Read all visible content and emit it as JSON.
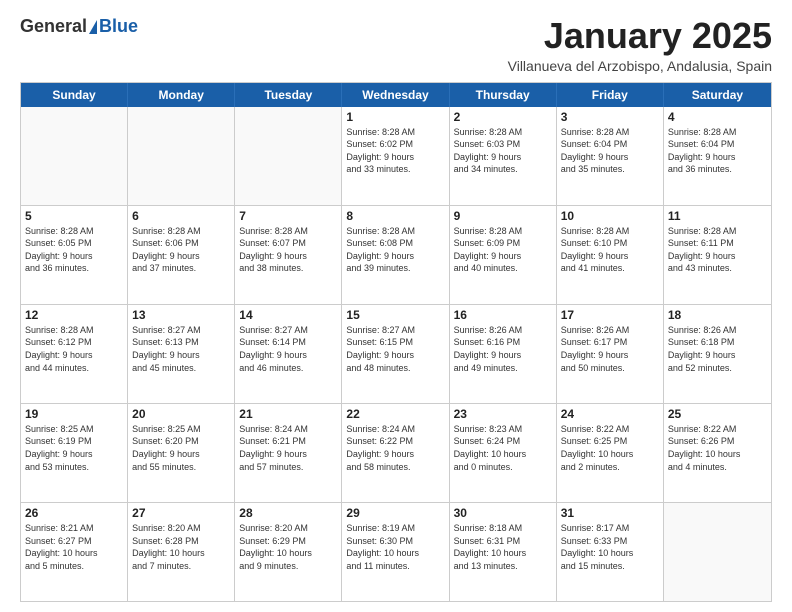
{
  "logo": {
    "general": "General",
    "blue": "Blue"
  },
  "title": "January 2025",
  "location": "Villanueva del Arzobispo, Andalusia, Spain",
  "days_of_week": [
    "Sunday",
    "Monday",
    "Tuesday",
    "Wednesday",
    "Thursday",
    "Friday",
    "Saturday"
  ],
  "weeks": [
    [
      {
        "day": "",
        "info": ""
      },
      {
        "day": "",
        "info": ""
      },
      {
        "day": "",
        "info": ""
      },
      {
        "day": "1",
        "info": "Sunrise: 8:28 AM\nSunset: 6:02 PM\nDaylight: 9 hours\nand 33 minutes."
      },
      {
        "day": "2",
        "info": "Sunrise: 8:28 AM\nSunset: 6:03 PM\nDaylight: 9 hours\nand 34 minutes."
      },
      {
        "day": "3",
        "info": "Sunrise: 8:28 AM\nSunset: 6:04 PM\nDaylight: 9 hours\nand 35 minutes."
      },
      {
        "day": "4",
        "info": "Sunrise: 8:28 AM\nSunset: 6:04 PM\nDaylight: 9 hours\nand 36 minutes."
      }
    ],
    [
      {
        "day": "5",
        "info": "Sunrise: 8:28 AM\nSunset: 6:05 PM\nDaylight: 9 hours\nand 36 minutes."
      },
      {
        "day": "6",
        "info": "Sunrise: 8:28 AM\nSunset: 6:06 PM\nDaylight: 9 hours\nand 37 minutes."
      },
      {
        "day": "7",
        "info": "Sunrise: 8:28 AM\nSunset: 6:07 PM\nDaylight: 9 hours\nand 38 minutes."
      },
      {
        "day": "8",
        "info": "Sunrise: 8:28 AM\nSunset: 6:08 PM\nDaylight: 9 hours\nand 39 minutes."
      },
      {
        "day": "9",
        "info": "Sunrise: 8:28 AM\nSunset: 6:09 PM\nDaylight: 9 hours\nand 40 minutes."
      },
      {
        "day": "10",
        "info": "Sunrise: 8:28 AM\nSunset: 6:10 PM\nDaylight: 9 hours\nand 41 minutes."
      },
      {
        "day": "11",
        "info": "Sunrise: 8:28 AM\nSunset: 6:11 PM\nDaylight: 9 hours\nand 43 minutes."
      }
    ],
    [
      {
        "day": "12",
        "info": "Sunrise: 8:28 AM\nSunset: 6:12 PM\nDaylight: 9 hours\nand 44 minutes."
      },
      {
        "day": "13",
        "info": "Sunrise: 8:27 AM\nSunset: 6:13 PM\nDaylight: 9 hours\nand 45 minutes."
      },
      {
        "day": "14",
        "info": "Sunrise: 8:27 AM\nSunset: 6:14 PM\nDaylight: 9 hours\nand 46 minutes."
      },
      {
        "day": "15",
        "info": "Sunrise: 8:27 AM\nSunset: 6:15 PM\nDaylight: 9 hours\nand 48 minutes."
      },
      {
        "day": "16",
        "info": "Sunrise: 8:26 AM\nSunset: 6:16 PM\nDaylight: 9 hours\nand 49 minutes."
      },
      {
        "day": "17",
        "info": "Sunrise: 8:26 AM\nSunset: 6:17 PM\nDaylight: 9 hours\nand 50 minutes."
      },
      {
        "day": "18",
        "info": "Sunrise: 8:26 AM\nSunset: 6:18 PM\nDaylight: 9 hours\nand 52 minutes."
      }
    ],
    [
      {
        "day": "19",
        "info": "Sunrise: 8:25 AM\nSunset: 6:19 PM\nDaylight: 9 hours\nand 53 minutes."
      },
      {
        "day": "20",
        "info": "Sunrise: 8:25 AM\nSunset: 6:20 PM\nDaylight: 9 hours\nand 55 minutes."
      },
      {
        "day": "21",
        "info": "Sunrise: 8:24 AM\nSunset: 6:21 PM\nDaylight: 9 hours\nand 57 minutes."
      },
      {
        "day": "22",
        "info": "Sunrise: 8:24 AM\nSunset: 6:22 PM\nDaylight: 9 hours\nand 58 minutes."
      },
      {
        "day": "23",
        "info": "Sunrise: 8:23 AM\nSunset: 6:24 PM\nDaylight: 10 hours\nand 0 minutes."
      },
      {
        "day": "24",
        "info": "Sunrise: 8:22 AM\nSunset: 6:25 PM\nDaylight: 10 hours\nand 2 minutes."
      },
      {
        "day": "25",
        "info": "Sunrise: 8:22 AM\nSunset: 6:26 PM\nDaylight: 10 hours\nand 4 minutes."
      }
    ],
    [
      {
        "day": "26",
        "info": "Sunrise: 8:21 AM\nSunset: 6:27 PM\nDaylight: 10 hours\nand 5 minutes."
      },
      {
        "day": "27",
        "info": "Sunrise: 8:20 AM\nSunset: 6:28 PM\nDaylight: 10 hours\nand 7 minutes."
      },
      {
        "day": "28",
        "info": "Sunrise: 8:20 AM\nSunset: 6:29 PM\nDaylight: 10 hours\nand 9 minutes."
      },
      {
        "day": "29",
        "info": "Sunrise: 8:19 AM\nSunset: 6:30 PM\nDaylight: 10 hours\nand 11 minutes."
      },
      {
        "day": "30",
        "info": "Sunrise: 8:18 AM\nSunset: 6:31 PM\nDaylight: 10 hours\nand 13 minutes."
      },
      {
        "day": "31",
        "info": "Sunrise: 8:17 AM\nSunset: 6:33 PM\nDaylight: 10 hours\nand 15 minutes."
      },
      {
        "day": "",
        "info": ""
      }
    ]
  ]
}
